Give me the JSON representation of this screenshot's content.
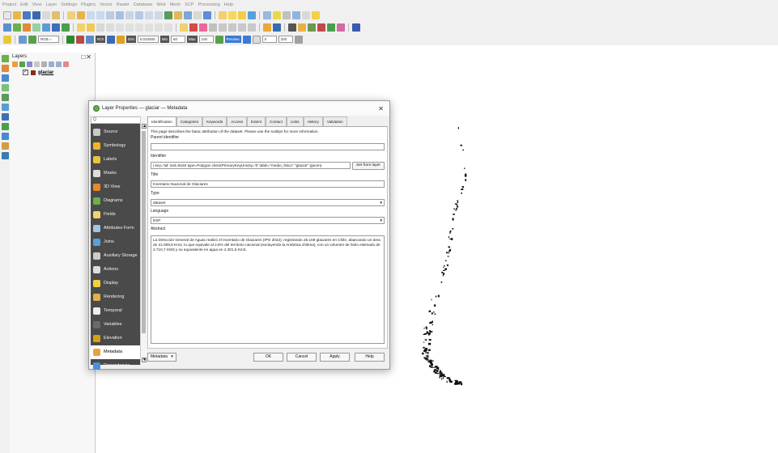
{
  "menu": [
    "Project",
    "Edit",
    "View",
    "Layer",
    "Settings",
    "Plugins",
    "Vector",
    "Raster",
    "Database",
    "Web",
    "Mesh",
    "SCP",
    "Processing",
    "Help"
  ],
  "toolbar": {
    "rgb_label": "RGB =",
    "roi_label": "ROI",
    "dist_label": "Dist",
    "dist_value": "0.010000",
    "min_label": "Min",
    "min_value": "60",
    "max_label": "Max",
    "max_value": "100",
    "preview_label": "Preview",
    "size_value_1": "0",
    "size_value_2": "200"
  },
  "layers_panel": {
    "title": "Layers",
    "controls": "□✕",
    "layer_name": "glaciar"
  },
  "dialog": {
    "title": "Layer Properties — glaciar — Metadata",
    "close": "✕",
    "search_glyph": "Q",
    "sidebar": [
      {
        "label": "Source",
        "icon": "source-icon",
        "color": "#c9c9c9"
      },
      {
        "label": "Symbology",
        "icon": "symbology-icon",
        "color": "#f0b323"
      },
      {
        "label": "Labels",
        "icon": "labels-icon",
        "color": "#e8c53a"
      },
      {
        "label": "Masks",
        "icon": "masks-icon",
        "color": "#dddddd"
      },
      {
        "label": "3D View",
        "icon": "3d-view-icon",
        "color": "#e8892a"
      },
      {
        "label": "Diagrams",
        "icon": "diagrams-icon",
        "color": "#6ab04c"
      },
      {
        "label": "Fields",
        "icon": "fields-icon",
        "color": "#f2d46b"
      },
      {
        "label": "Attributes Form",
        "icon": "attributes-form-icon",
        "color": "#9fc5e8"
      },
      {
        "label": "Joins",
        "icon": "joins-icon",
        "color": "#5aa0d8"
      },
      {
        "label": "Auxiliary Storage",
        "icon": "auxiliary-storage-icon",
        "color": "#cccccc"
      },
      {
        "label": "Actions",
        "icon": "actions-icon",
        "color": "#dddddd"
      },
      {
        "label": "Display",
        "icon": "display-icon",
        "color": "#f4d03f"
      },
      {
        "label": "Rendering",
        "icon": "rendering-icon",
        "color": "#e3b04b"
      },
      {
        "label": "Temporal",
        "icon": "temporal-icon",
        "color": "#eeeeee"
      },
      {
        "label": "Variables",
        "icon": "variables-icon",
        "color": "#6a6a6a"
      },
      {
        "label": "Elevation",
        "icon": "elevation-icon",
        "color": "#d4a017"
      },
      {
        "label": "Metadata",
        "icon": "metadata-icon",
        "color": "#e9a23b",
        "active": true
      },
      {
        "label": "Dependencie",
        "icon": "dependencies-icon",
        "color": "#4a90d9"
      }
    ],
    "tabs": [
      "Identification",
      "Categories",
      "Keywords",
      "Access",
      "Extent",
      "Contact",
      "Links",
      "History",
      "Validation"
    ],
    "intro": "This page describes the basic attribution of the dataset. Please use the tooltips for more information.",
    "parent_identifier_label": "Parent identifier",
    "parent_identifier_value": "",
    "identifier_label": "Identifier",
    "identifier_value": "| key='tid' srid=9184 type=Polygon checkPrimaryKeyUnicity='0' table=\"medio_fisico\".\"glaciar\" (geom)",
    "set_from_layer": "Set from layer",
    "title_label": "Title",
    "title_value": "Inventario Nacional de Glaciares",
    "type_label": "Type",
    "type_value": "dataset",
    "language_label": "Language",
    "language_value": "ESP",
    "abstract_label": "Abstract",
    "abstract_value": "La Dirección General de Aguas realizó el Inventario de Glaciares (IPG 2022), registrando 26.169 glaciares en Chile, abarcando un área de 21.009,8 Km2, lo que equivale al 2,8% del territorio nacional (excluyendo la Antártica chilena), con un volumen de hielo estimado de 2.710,7 KM3 y su equivalente en agua en 2.301,5 Km3.",
    "footer": {
      "style_menu": "Metadata",
      "ok": "OK",
      "cancel": "Cancel",
      "apply": "Apply",
      "help": "Help"
    }
  },
  "colors": {
    "sidebar_bg": "#4a4a4a",
    "map_feature": "#111111"
  }
}
